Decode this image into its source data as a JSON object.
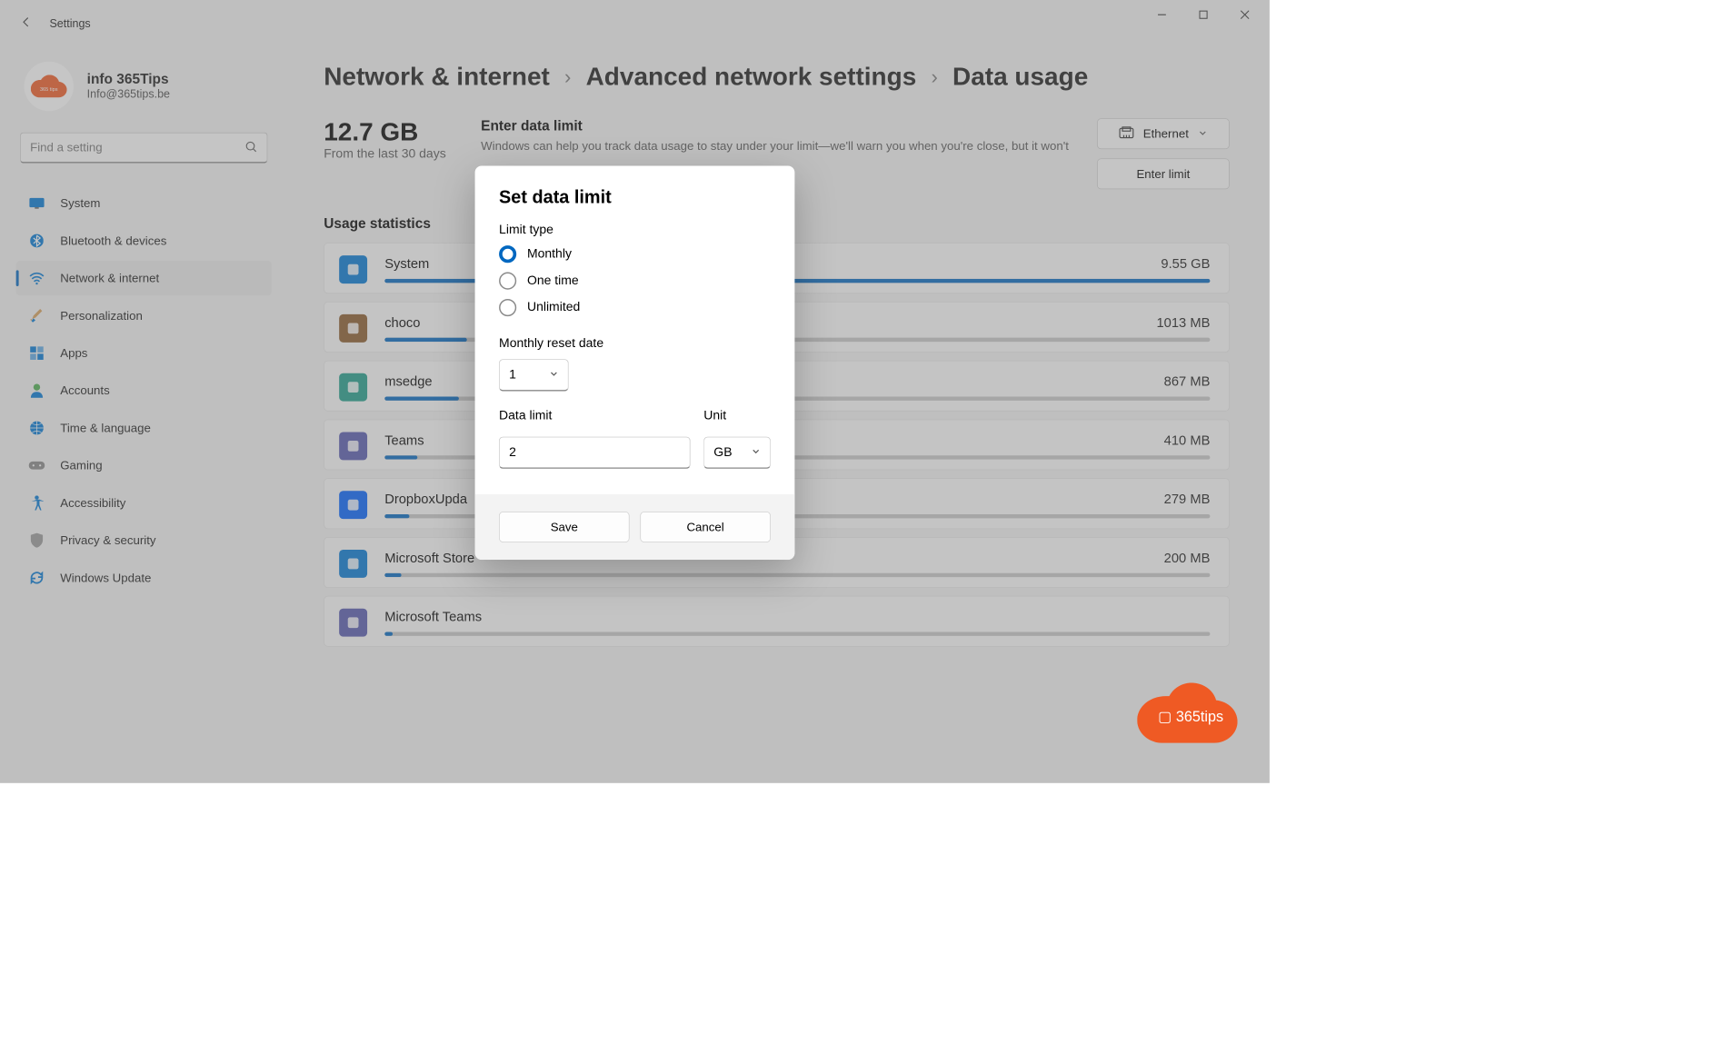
{
  "window": {
    "title": "Settings"
  },
  "user": {
    "name": "info 365Tips",
    "email": "Info@365tips.be"
  },
  "search": {
    "placeholder": "Find a setting"
  },
  "sidebar": {
    "items": [
      {
        "label": "System"
      },
      {
        "label": "Bluetooth & devices"
      },
      {
        "label": "Network & internet"
      },
      {
        "label": "Personalization"
      },
      {
        "label": "Apps"
      },
      {
        "label": "Accounts"
      },
      {
        "label": "Time & language"
      },
      {
        "label": "Gaming"
      },
      {
        "label": "Accessibility"
      },
      {
        "label": "Privacy & security"
      },
      {
        "label": "Windows Update"
      }
    ]
  },
  "breadcrumb": {
    "a": "Network & internet",
    "b": "Advanced network settings",
    "c": "Data usage"
  },
  "summary": {
    "total": "12.7 GB",
    "period": "From the last 30 days",
    "enter_title": "Enter data limit",
    "enter_desc": "Windows can help you track data usage to stay under your limit—we'll warn you when you're close, but it won't",
    "connection": "Ethernet",
    "enter_btn": "Enter limit"
  },
  "usage_title": "Usage statistics",
  "apps": [
    {
      "name": "System",
      "usage": "9.55 GB",
      "pct": 100
    },
    {
      "name": "choco",
      "usage": "1013 MB",
      "pct": 10
    },
    {
      "name": "msedge",
      "usage": "867 MB",
      "pct": 9
    },
    {
      "name": "Teams",
      "usage": "410 MB",
      "pct": 4
    },
    {
      "name": "DropboxUpda",
      "usage": "279 MB",
      "pct": 3
    },
    {
      "name": "Microsoft Store",
      "usage": "200 MB",
      "pct": 2
    },
    {
      "name": "Microsoft Teams",
      "usage": "",
      "pct": 1
    }
  ],
  "dialog": {
    "title": "Set data limit",
    "limit_type_label": "Limit type",
    "options": {
      "monthly": "Monthly",
      "onetime": "One time",
      "unlimited": "Unlimited"
    },
    "reset_label": "Monthly reset date",
    "reset_value": "1",
    "data_limit_label": "Data limit",
    "data_limit_value": "2",
    "unit_label": "Unit",
    "unit_value": "GB",
    "save": "Save",
    "cancel": "Cancel"
  },
  "colors": {
    "accent": "#0067c0",
    "brand": "#ef5a24"
  },
  "badge": {
    "text": "365tips"
  }
}
